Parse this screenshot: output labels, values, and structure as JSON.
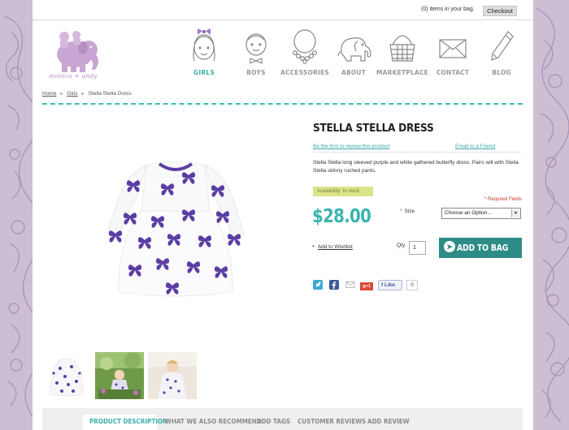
{
  "header": {
    "bag_text": "(0) items in your bag.",
    "checkout_label": "Checkout",
    "logo_text": "monica + andy"
  },
  "nav": [
    {
      "label": "GIRLS",
      "icon": "girl-face-icon",
      "active": true
    },
    {
      "label": "BOYS",
      "icon": "boy-face-icon",
      "active": false
    },
    {
      "label": "ACCESSORIES",
      "icon": "necklace-icon",
      "active": false
    },
    {
      "label": "ABOUT",
      "icon": "elephant-icon",
      "active": false
    },
    {
      "label": "MARKETPLACE",
      "icon": "basket-icon",
      "active": false
    },
    {
      "label": "CONTACT",
      "icon": "envelope-icon",
      "active": false
    },
    {
      "label": "BLOG",
      "icon": "pencil-icon",
      "active": false
    }
  ],
  "breadcrumb": {
    "home": "Home",
    "category": "Girls",
    "current": "Stella Stella Dress"
  },
  "product": {
    "title": "STELLA STELLA DRESS",
    "review_link": "Be the first to review this product",
    "email_link": "Email to a Friend",
    "description": "Stella Stella long sleeved purple and white gathered butterfly dress. Pairs will with Stella Stella skinny ruched pants.",
    "availability": "Availability: In stock",
    "required_note": "* Required Fields",
    "price": "$28.00",
    "size_label": "Size",
    "size_star": "*",
    "size_value": "Choose an Option...",
    "wishlist_label": "Add to Wishlist",
    "qty_label": "Qty",
    "qty_value": "1",
    "add_to_bag_label": "ADD TO BAG"
  },
  "share": {
    "like_label": "Like",
    "like_count": "0",
    "gplus_label": "g+1"
  },
  "tabs": [
    {
      "label": "PRODUCT DESCRIPTION",
      "active": true
    },
    {
      "label": "WHAT WE ALSO RECOMMEND",
      "active": false
    },
    {
      "label": "ADD TAGS",
      "active": false
    },
    {
      "label": "CUSTOMER REVIEWS",
      "active": false
    },
    {
      "label": "ADD REVIEW",
      "active": false
    }
  ],
  "colors": {
    "accent": "#3bb0ac",
    "button": "#2e8c86",
    "purple": "#5b3ea3",
    "availability_bg": "#dbe48a",
    "background_pattern": "#cdbfd3"
  }
}
